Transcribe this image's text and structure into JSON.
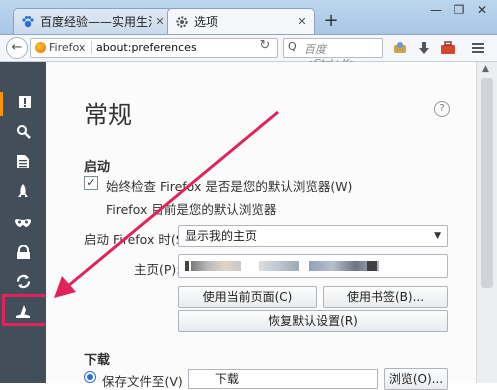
{
  "tabs": [
    {
      "label": "百度经验——实用生活指南",
      "icon": "paw-icon"
    },
    {
      "label": "选项",
      "icon": "gear-icon"
    }
  ],
  "window": {
    "minimize": "—",
    "restore": "❐",
    "close": "✕"
  },
  "newtab_label": "+",
  "toolbar": {
    "identity_label": "Firefox",
    "url": "about:preferences",
    "search_placeholder": "百度 <Ctrl+K>"
  },
  "sidebar": {
    "items": [
      {
        "name": "general",
        "icon": "general-icon",
        "glyph": "▣"
      },
      {
        "name": "search",
        "icon": "search-icon",
        "glyph": "⌕"
      },
      {
        "name": "content",
        "icon": "content-icon",
        "glyph": "≣"
      },
      {
        "name": "applications",
        "icon": "rocket-icon",
        "glyph": "🚀"
      },
      {
        "name": "privacy",
        "icon": "mask-icon",
        "glyph": "∞"
      },
      {
        "name": "security",
        "icon": "lock-icon",
        "glyph": "🔒"
      },
      {
        "name": "sync",
        "icon": "sync-icon",
        "glyph": "⟳"
      },
      {
        "name": "advanced",
        "icon": "wizard-hat-icon",
        "glyph": "🧙"
      }
    ]
  },
  "page": {
    "title": "常规",
    "help_glyph": "?",
    "startup": {
      "heading": "启动",
      "checkbox_label": "始终检查 Firefox 是否是您的默认浏览器(W)",
      "checkbox_checked": true,
      "default_status": "Firefox 目前是您的默认浏览器",
      "when_starts_label": "启动 Firefox 时(S):",
      "when_starts_value": "显示我的主页",
      "homepage_label": "主页(P):",
      "use_current_button": "使用当前页面(C)",
      "use_bookmark_button": "使用书签(B)...",
      "restore_default_button": "恢复默认设置(R)"
    },
    "downloads": {
      "heading": "下载",
      "save_to_label": "保存文件至(V)",
      "folder_value": "下载",
      "browse_button": "浏览(O)..."
    }
  },
  "colors": {
    "highlight": "#e0235a",
    "sidebar_bg": "#424f5a",
    "accent": "#ff9500"
  }
}
